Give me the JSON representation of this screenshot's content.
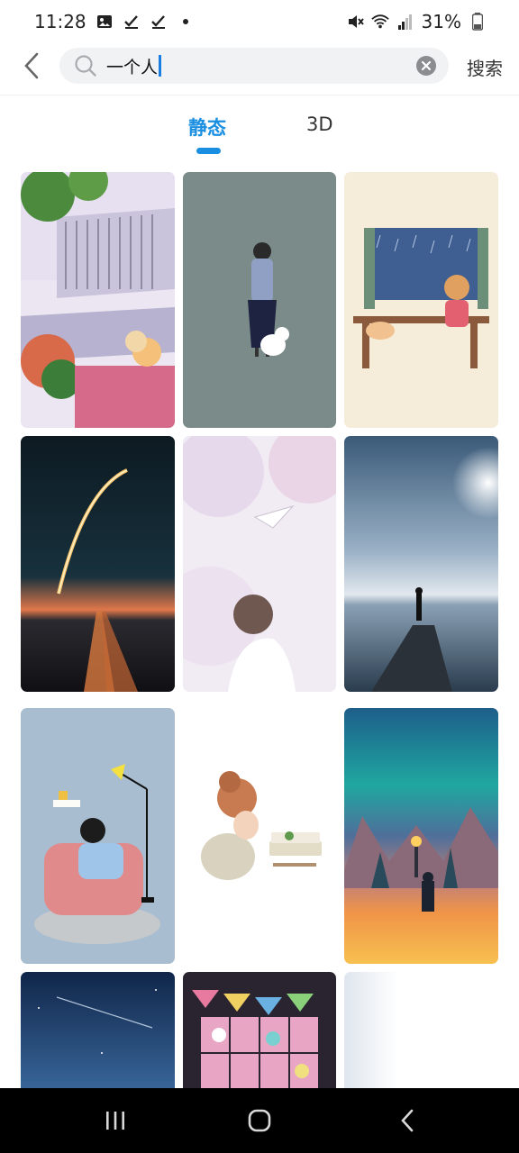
{
  "status_bar": {
    "time": "11:28",
    "battery": "31%",
    "icons": [
      "gallery-icon",
      "check-icon",
      "check-icon",
      "dot-icon",
      "mute-icon",
      "wifi-icon",
      "signal-icon",
      "battery-icon"
    ]
  },
  "search": {
    "query": "一个人",
    "submit_label": "搜索"
  },
  "tabs": [
    {
      "label": "静态",
      "active": true
    },
    {
      "label": "3D",
      "active": false
    }
  ],
  "colors": {
    "accent": "#1a8ee0",
    "nav_bar": "#000000"
  },
  "wallpapers": [
    "illustration-girl-balcony",
    "illustration-woman-with-dog",
    "illustration-girl-rainy-window",
    "photo-rocket-launch",
    "watercolor-girl-paper-plane",
    "photo-man-on-pier",
    "illustration-girl-armchair-lamp",
    "watercolor-girl-reading",
    "photo-aurora-torch",
    "photo-night-sky-meteor",
    "illustration-colorful-window",
    "photo-white-gradient"
  ]
}
